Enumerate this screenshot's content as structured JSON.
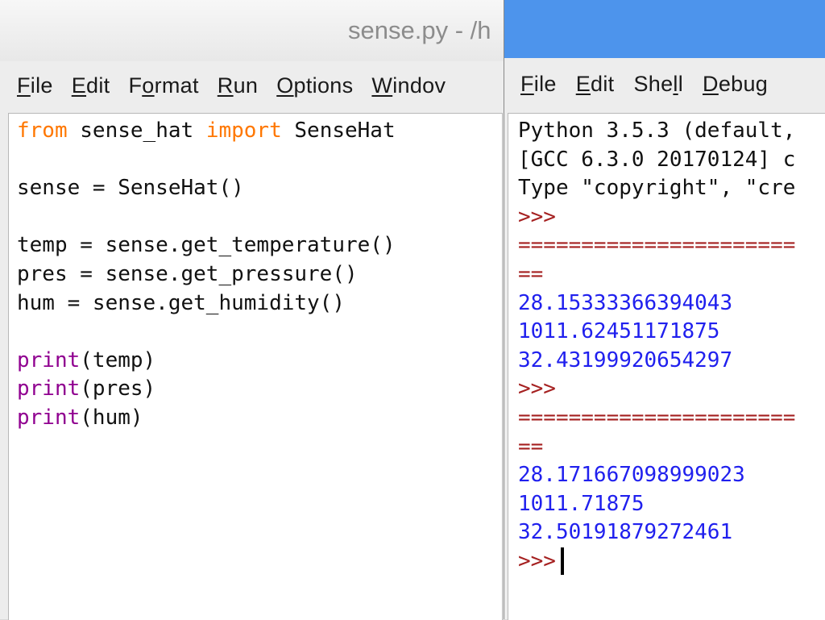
{
  "editor": {
    "title": "sense.py - /h",
    "menu": [
      {
        "pre": "",
        "ul": "F",
        "post": "ile"
      },
      {
        "pre": "",
        "ul": "E",
        "post": "dit"
      },
      {
        "pre": "F",
        "ul": "o",
        "post": "rmat"
      },
      {
        "pre": "",
        "ul": "R",
        "post": "un"
      },
      {
        "pre": "",
        "ul": "O",
        "post": "ptions"
      },
      {
        "pre": "",
        "ul": "W",
        "post": "indov"
      }
    ],
    "code": {
      "line1_kw_from": "from",
      "line1_module": " sense_hat ",
      "line1_kw_import": "import",
      "line1_name": " SenseHat",
      "line3": "sense = SenseHat()",
      "line5": "temp = sense.get_temperature()",
      "line6": "pres = sense.get_pressure()",
      "line7": "hum = sense.get_humidity()",
      "print_kw": "print",
      "line9_args": "(temp)",
      "line10_args": "(pres)",
      "line11_args": "(hum)"
    }
  },
  "shell": {
    "menu": [
      {
        "pre": "",
        "ul": "F",
        "post": "ile"
      },
      {
        "pre": "",
        "ul": "E",
        "post": "dit"
      },
      {
        "pre": "She",
        "ul": "l",
        "post": "l"
      },
      {
        "pre": "",
        "ul": "D",
        "post": "ebug"
      }
    ],
    "output": {
      "banner1": "Python 3.5.3 (default,",
      "banner2": "[GCC 6.3.0 20170124] c",
      "banner3": "Type \"copyright\", \"cre",
      "prompt": ">>>",
      "separator": "======================",
      "separator_end": "==",
      "run1": [
        "28.15333366394043",
        "1011.62451171875",
        "32.43199920654297"
      ],
      "run2": [
        "28.171667098999023",
        "1011.71875",
        "32.50191879272461"
      ]
    }
  }
}
